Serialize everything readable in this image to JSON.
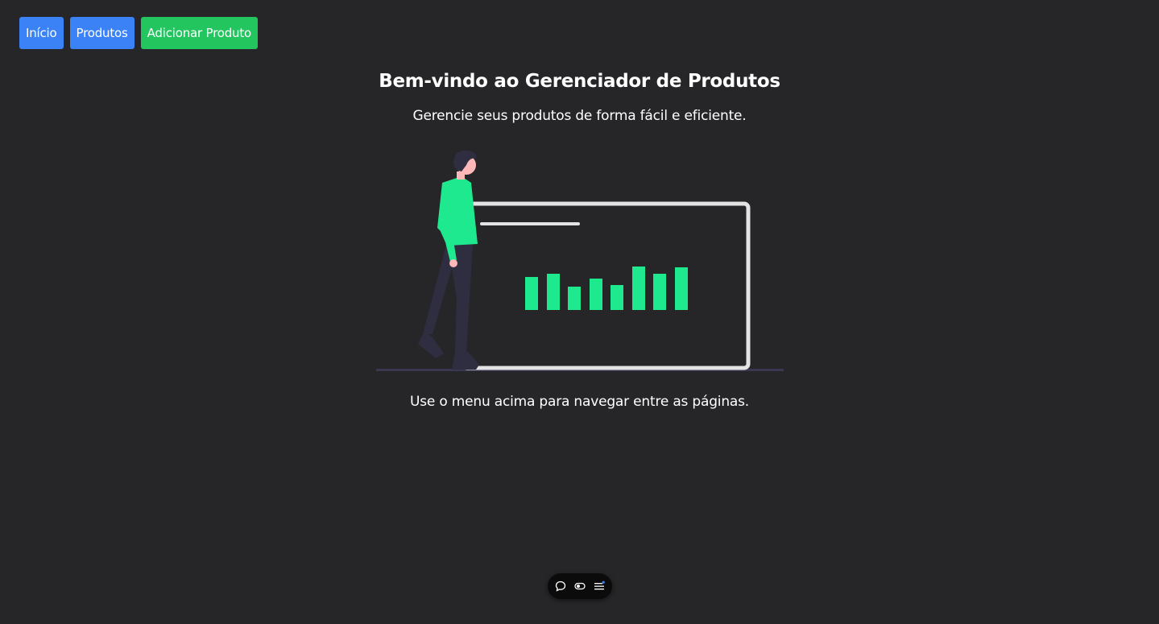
{
  "nav": {
    "items": [
      {
        "label": "Início",
        "color": "#3b82f6"
      },
      {
        "label": "Produtos",
        "color": "#3b82f6"
      },
      {
        "label": "Adicionar Produto",
        "color": "#22c55e"
      }
    ]
  },
  "hero": {
    "title": "Bem-vindo ao Gerenciador de Produtos",
    "subtitle": "Gerencie seus produtos de forma fácil e eficiente.",
    "illustration_icon": "presentation-dashboard-illustration",
    "footer": "Use o menu acima para navegar entre as páginas."
  },
  "toolbar": {
    "icons": [
      "comment-icon",
      "toggle-icon",
      "menu-icon"
    ]
  },
  "colors": {
    "background": "#262628",
    "accent_blue": "#3b82f6",
    "accent_green": "#22c55e",
    "illustration_green": "#1ee98f"
  }
}
